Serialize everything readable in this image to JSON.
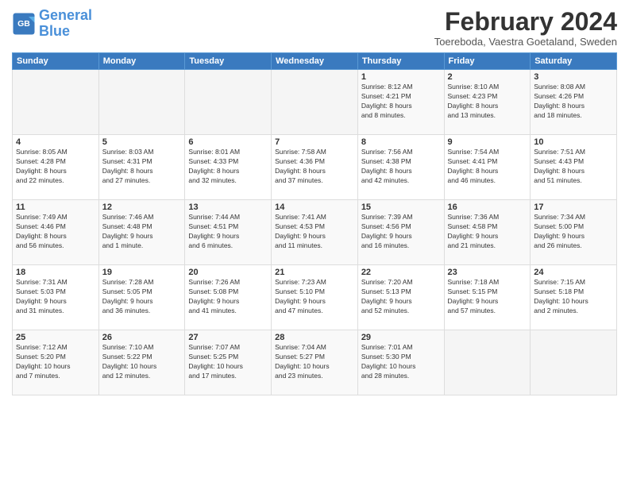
{
  "logo": {
    "line1": "General",
    "line2": "Blue"
  },
  "title": "February 2024",
  "subtitle": "Toereboda, Vaestra Goetaland, Sweden",
  "days_header": [
    "Sunday",
    "Monday",
    "Tuesday",
    "Wednesday",
    "Thursday",
    "Friday",
    "Saturday"
  ],
  "weeks": [
    [
      {
        "day": "",
        "info": ""
      },
      {
        "day": "",
        "info": ""
      },
      {
        "day": "",
        "info": ""
      },
      {
        "day": "",
        "info": ""
      },
      {
        "day": "1",
        "info": "Sunrise: 8:12 AM\nSunset: 4:21 PM\nDaylight: 8 hours\nand 8 minutes."
      },
      {
        "day": "2",
        "info": "Sunrise: 8:10 AM\nSunset: 4:23 PM\nDaylight: 8 hours\nand 13 minutes."
      },
      {
        "day": "3",
        "info": "Sunrise: 8:08 AM\nSunset: 4:26 PM\nDaylight: 8 hours\nand 18 minutes."
      }
    ],
    [
      {
        "day": "4",
        "info": "Sunrise: 8:05 AM\nSunset: 4:28 PM\nDaylight: 8 hours\nand 22 minutes."
      },
      {
        "day": "5",
        "info": "Sunrise: 8:03 AM\nSunset: 4:31 PM\nDaylight: 8 hours\nand 27 minutes."
      },
      {
        "day": "6",
        "info": "Sunrise: 8:01 AM\nSunset: 4:33 PM\nDaylight: 8 hours\nand 32 minutes."
      },
      {
        "day": "7",
        "info": "Sunrise: 7:58 AM\nSunset: 4:36 PM\nDaylight: 8 hours\nand 37 minutes."
      },
      {
        "day": "8",
        "info": "Sunrise: 7:56 AM\nSunset: 4:38 PM\nDaylight: 8 hours\nand 42 minutes."
      },
      {
        "day": "9",
        "info": "Sunrise: 7:54 AM\nSunset: 4:41 PM\nDaylight: 8 hours\nand 46 minutes."
      },
      {
        "day": "10",
        "info": "Sunrise: 7:51 AM\nSunset: 4:43 PM\nDaylight: 8 hours\nand 51 minutes."
      }
    ],
    [
      {
        "day": "11",
        "info": "Sunrise: 7:49 AM\nSunset: 4:46 PM\nDaylight: 8 hours\nand 56 minutes."
      },
      {
        "day": "12",
        "info": "Sunrise: 7:46 AM\nSunset: 4:48 PM\nDaylight: 9 hours\nand 1 minute."
      },
      {
        "day": "13",
        "info": "Sunrise: 7:44 AM\nSunset: 4:51 PM\nDaylight: 9 hours\nand 6 minutes."
      },
      {
        "day": "14",
        "info": "Sunrise: 7:41 AM\nSunset: 4:53 PM\nDaylight: 9 hours\nand 11 minutes."
      },
      {
        "day": "15",
        "info": "Sunrise: 7:39 AM\nSunset: 4:56 PM\nDaylight: 9 hours\nand 16 minutes."
      },
      {
        "day": "16",
        "info": "Sunrise: 7:36 AM\nSunset: 4:58 PM\nDaylight: 9 hours\nand 21 minutes."
      },
      {
        "day": "17",
        "info": "Sunrise: 7:34 AM\nSunset: 5:00 PM\nDaylight: 9 hours\nand 26 minutes."
      }
    ],
    [
      {
        "day": "18",
        "info": "Sunrise: 7:31 AM\nSunset: 5:03 PM\nDaylight: 9 hours\nand 31 minutes."
      },
      {
        "day": "19",
        "info": "Sunrise: 7:28 AM\nSunset: 5:05 PM\nDaylight: 9 hours\nand 36 minutes."
      },
      {
        "day": "20",
        "info": "Sunrise: 7:26 AM\nSunset: 5:08 PM\nDaylight: 9 hours\nand 41 minutes."
      },
      {
        "day": "21",
        "info": "Sunrise: 7:23 AM\nSunset: 5:10 PM\nDaylight: 9 hours\nand 47 minutes."
      },
      {
        "day": "22",
        "info": "Sunrise: 7:20 AM\nSunset: 5:13 PM\nDaylight: 9 hours\nand 52 minutes."
      },
      {
        "day": "23",
        "info": "Sunrise: 7:18 AM\nSunset: 5:15 PM\nDaylight: 9 hours\nand 57 minutes."
      },
      {
        "day": "24",
        "info": "Sunrise: 7:15 AM\nSunset: 5:18 PM\nDaylight: 10 hours\nand 2 minutes."
      }
    ],
    [
      {
        "day": "25",
        "info": "Sunrise: 7:12 AM\nSunset: 5:20 PM\nDaylight: 10 hours\nand 7 minutes."
      },
      {
        "day": "26",
        "info": "Sunrise: 7:10 AM\nSunset: 5:22 PM\nDaylight: 10 hours\nand 12 minutes."
      },
      {
        "day": "27",
        "info": "Sunrise: 7:07 AM\nSunset: 5:25 PM\nDaylight: 10 hours\nand 17 minutes."
      },
      {
        "day": "28",
        "info": "Sunrise: 7:04 AM\nSunset: 5:27 PM\nDaylight: 10 hours\nand 23 minutes."
      },
      {
        "day": "29",
        "info": "Sunrise: 7:01 AM\nSunset: 5:30 PM\nDaylight: 10 hours\nand 28 minutes."
      },
      {
        "day": "",
        "info": ""
      },
      {
        "day": "",
        "info": ""
      }
    ]
  ]
}
